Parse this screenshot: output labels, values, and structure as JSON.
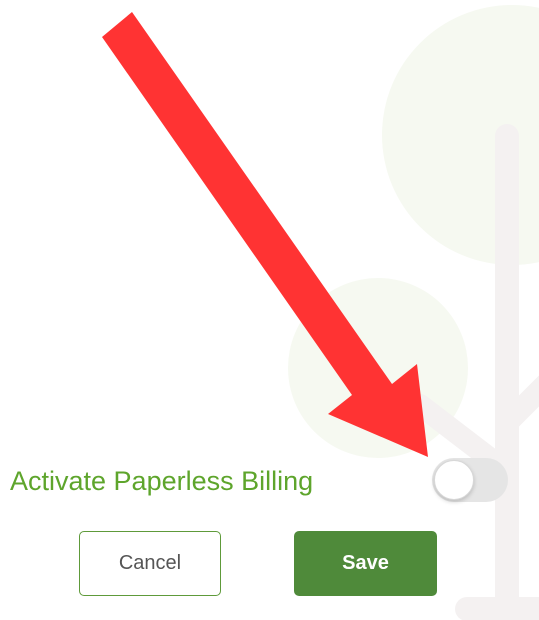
{
  "paperless": {
    "label": "Activate Paperless Billing",
    "toggle_on": false
  },
  "buttons": {
    "cancel_label": "Cancel",
    "save_label": "Save"
  },
  "colors": {
    "label_green": "#5ea52c",
    "save_green": "#4f8a3a",
    "annotation_arrow": "#ff2f2f"
  },
  "icons": {
    "background": "tree-illustration",
    "annotation": "red-arrow-icon"
  }
}
